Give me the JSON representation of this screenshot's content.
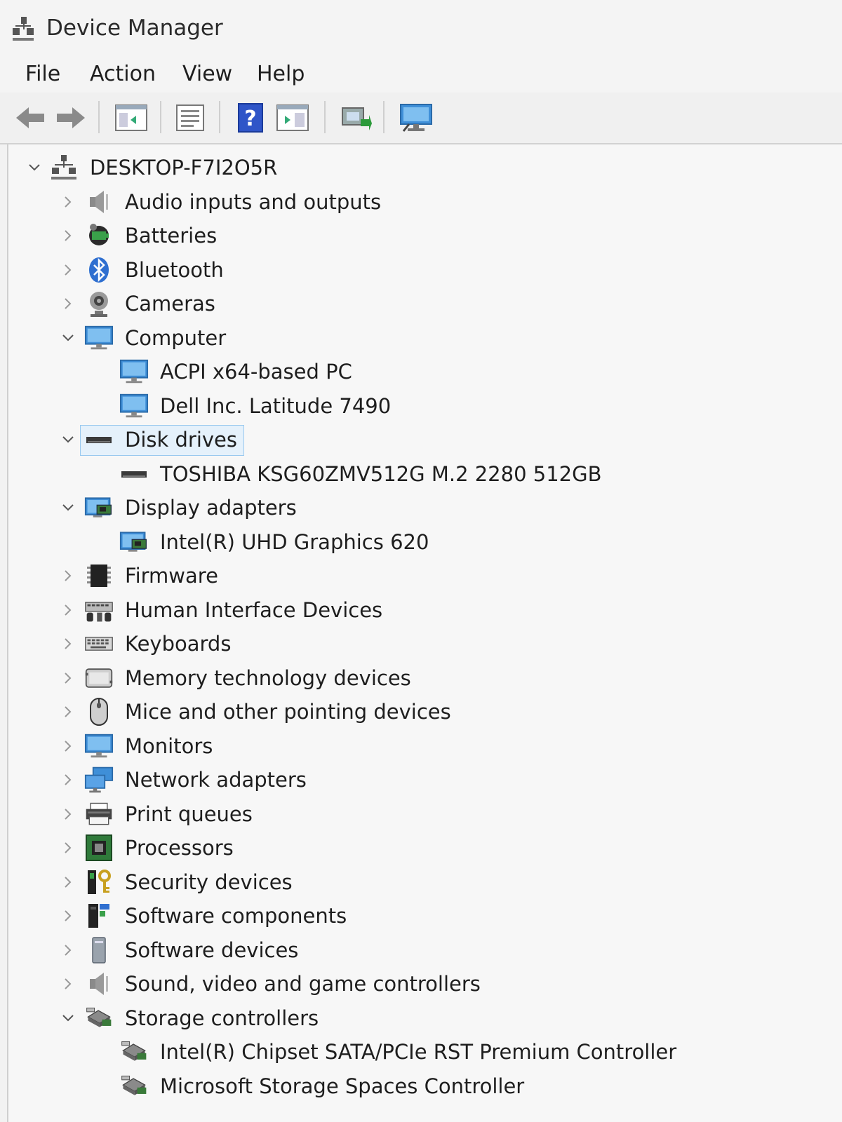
{
  "window": {
    "title": "Device Manager"
  },
  "menu": {
    "file": "File",
    "action": "Action",
    "view": "View",
    "help": "Help"
  },
  "toolbar": {
    "buttons": [
      "back-icon",
      "forward-icon",
      "show-hide-console-tree-icon",
      "properties-icon",
      "help-icon",
      "action-pane-icon",
      "update-driver-icon",
      "scan-hardware-icon"
    ]
  },
  "tree": {
    "root": "DESKTOP-F7I2O5R",
    "items": [
      {
        "label": "Audio inputs and outputs",
        "expanded": false,
        "icon": "speaker-icon"
      },
      {
        "label": "Batteries",
        "expanded": false,
        "icon": "battery-icon"
      },
      {
        "label": "Bluetooth",
        "expanded": false,
        "icon": "bluetooth-icon"
      },
      {
        "label": "Cameras",
        "expanded": false,
        "icon": "camera-icon"
      },
      {
        "label": "Computer",
        "expanded": true,
        "icon": "monitor-icon",
        "children": [
          "ACPI x64-based PC",
          "Dell Inc. Latitude 7490"
        ]
      },
      {
        "label": "Disk drives",
        "expanded": true,
        "selected": true,
        "icon": "disk-drive-icon",
        "children": [
          "TOSHIBA KSG60ZMV512G M.2 2280 512GB"
        ]
      },
      {
        "label": "Display adapters",
        "expanded": true,
        "icon": "display-adapter-icon",
        "children": [
          "Intel(R) UHD Graphics 620"
        ]
      },
      {
        "label": "Firmware",
        "expanded": false,
        "icon": "chip-icon"
      },
      {
        "label": "Human Interface Devices",
        "expanded": false,
        "icon": "hid-icon"
      },
      {
        "label": "Keyboards",
        "expanded": false,
        "icon": "keyboard-icon"
      },
      {
        "label": "Memory technology devices",
        "expanded": false,
        "icon": "memory-icon"
      },
      {
        "label": "Mice and other pointing devices",
        "expanded": false,
        "icon": "mouse-icon"
      },
      {
        "label": "Monitors",
        "expanded": false,
        "icon": "monitor-icon"
      },
      {
        "label": "Network adapters",
        "expanded": false,
        "icon": "network-icon"
      },
      {
        "label": "Print queues",
        "expanded": false,
        "icon": "printer-icon"
      },
      {
        "label": "Processors",
        "expanded": false,
        "icon": "processor-icon"
      },
      {
        "label": "Security devices",
        "expanded": false,
        "icon": "security-key-icon"
      },
      {
        "label": "Software components",
        "expanded": false,
        "icon": "software-component-icon"
      },
      {
        "label": "Software devices",
        "expanded": false,
        "icon": "software-device-icon"
      },
      {
        "label": "Sound, video and game controllers",
        "expanded": false,
        "icon": "speaker-icon"
      },
      {
        "label": "Storage controllers",
        "expanded": true,
        "icon": "storage-controller-icon",
        "children": [
          "Intel(R) Chipset SATA/PCIe RST Premium Controller",
          "Microsoft Storage Spaces Controller"
        ]
      }
    ]
  },
  "colors": {
    "selection_bg": "#e5f1fb",
    "selection_border": "#99c9ef",
    "monitor_blue": "#3f8fd8"
  }
}
